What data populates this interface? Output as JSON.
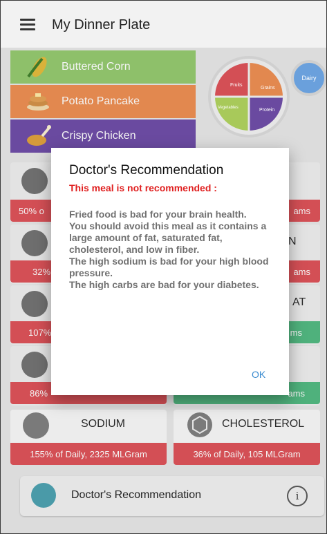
{
  "app": {
    "title": "My Dinner Plate"
  },
  "foods": [
    {
      "label": "Buttered Corn"
    },
    {
      "label": "Potato Pancake"
    },
    {
      "label": "Crispy Chicken"
    }
  ],
  "plate": {
    "fruits": "Fruits",
    "grains": "Grains",
    "vegetables": "Vegetables",
    "protein": "Protein",
    "dairy": "Dairy"
  },
  "nutrients": [
    {
      "visible_text": "50% o",
      "right_text": "ams",
      "title_tail": ""
    },
    {
      "visible_text": "32%",
      "right_text": "ams",
      "title_tail": "N"
    },
    {
      "visible_text": "107%",
      "right_text": "ms",
      "title_tail": "AT"
    },
    {
      "visible_text": "86%",
      "right_text": "ams",
      "title_tail": ""
    }
  ],
  "sodium": {
    "title": "SODIUM",
    "value": "155% of Daily, 2325 MLGram"
  },
  "cholesterol": {
    "title": "CHOLESTEROL",
    "value": "36% of Daily, 105 MLGram"
  },
  "doctor_bar": {
    "label": "Doctor's Recommendation",
    "info": "i"
  },
  "dialog": {
    "title": "Doctor's Recommendation",
    "warning": "This meal is not recommended :",
    "lines": [
      "Fried food is bad for your brain health.",
      "You should avoid this meal as it contains a large amount of fat, saturated fat, cholesterol, and low in fiber.",
      "The high sodium is bad for your high blood pressure.",
      "The high carbs are bad for your diabetes."
    ],
    "ok": "OK"
  },
  "colors": {
    "red": "#d34f55",
    "green": "#4fb17c",
    "link": "#3a8bd0",
    "warning": "#e02020"
  }
}
